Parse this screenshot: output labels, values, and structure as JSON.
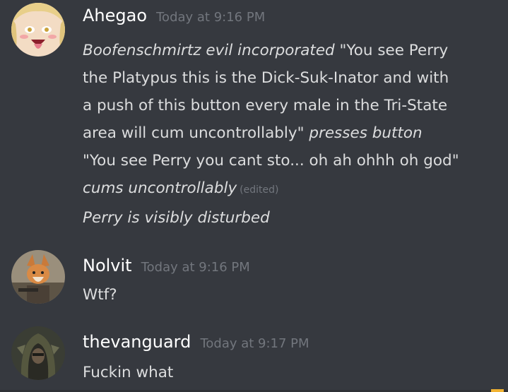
{
  "messages": [
    {
      "username": "Ahegao",
      "timestamp": "Today at 9:16 PM",
      "edited_label": "(edited)",
      "lines": [
        {
          "a": "Boofenschmirtz evil incorporated",
          "b": " \"You see Perry"
        },
        {
          "a": "the Platypus this is the Dick-Suk-Inator and with"
        },
        {
          "a": "a push of this button every male in the Tri-State"
        },
        {
          "a": "area will cum uncontrollably\" ",
          "b": "presses button"
        },
        {
          "a": "\"You see Perry you cant sto... oh ah ohhh oh god\""
        },
        {
          "a": "cums uncontrollably"
        },
        {
          "a": "Perry is visibly disturbed"
        }
      ]
    },
    {
      "username": "Nolvit",
      "timestamp": "Today at 9:16 PM",
      "text": "Wtf?"
    },
    {
      "username": "thevanguard",
      "timestamp": "Today at 9:17 PM",
      "text": "Fuckin what"
    }
  ],
  "colors": {
    "background": "#36393f",
    "username": "#ffffff",
    "timestamp": "#72767d",
    "text": "#dcddde"
  }
}
